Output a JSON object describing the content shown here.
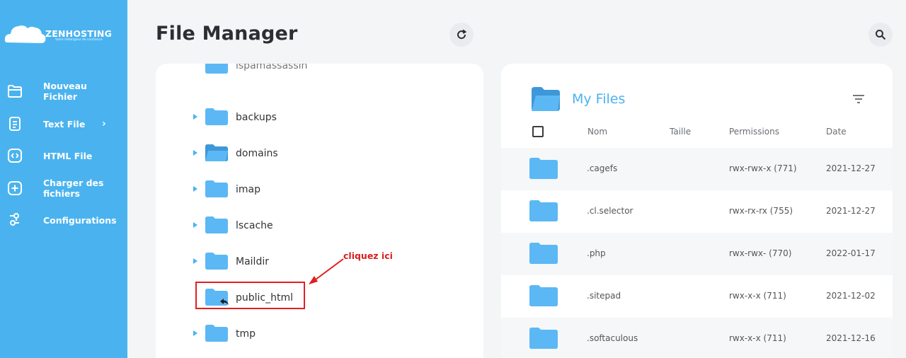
{
  "brand": {
    "name": "ZENHOSTING",
    "tagline": "Votre hébergeur de confiance"
  },
  "sidebar": {
    "items": [
      {
        "label": "Nouveau Fichier",
        "icon": "folder-outline-icon"
      },
      {
        "label": "Text File",
        "icon": "document-icon",
        "chevron": "›"
      },
      {
        "label": "HTML File",
        "icon": "code-icon"
      },
      {
        "label": "Charger des fichiers",
        "icon": "plus-box-icon"
      },
      {
        "label": "Configurations",
        "icon": "settings-sliders-icon"
      }
    ]
  },
  "header": {
    "title": "File Manager",
    "refresh_icon": "refresh-icon",
    "search_icon": "search-icon"
  },
  "tree": {
    "partial_label": "lspamassassin",
    "items": [
      {
        "label": "backups",
        "open": false
      },
      {
        "label": "domains",
        "open": true
      },
      {
        "label": "imap",
        "open": false
      },
      {
        "label": "lscache",
        "open": false
      },
      {
        "label": "Maildir",
        "open": false
      },
      {
        "label": "public_html",
        "open": false,
        "highlighted": true
      },
      {
        "label": "tmp",
        "open": false
      }
    ],
    "annotation": "cliquez ici"
  },
  "files": {
    "title": "My Files",
    "filter_icon": "filter-icon",
    "columns": {
      "name": "Nom",
      "size": "Taille",
      "permissions": "Permissions",
      "date": "Date"
    },
    "rows": [
      {
        "name": ".cagefs",
        "size": "",
        "permissions": "rwx-rwx-x (771)",
        "date": "2021-12-27"
      },
      {
        "name": ".cl.selector",
        "size": "",
        "permissions": "rwx-rx-rx (755)",
        "date": "2021-12-27"
      },
      {
        "name": ".php",
        "size": "",
        "permissions": "rwx-rwx- (770)",
        "date": "2022-01-17"
      },
      {
        "name": ".sitepad",
        "size": "",
        "permissions": "rwx-x-x (711)",
        "date": "2021-12-02"
      },
      {
        "name": ".softaculous",
        "size": "",
        "permissions": "rwx-x-x (711)",
        "date": "2021-12-16"
      }
    ]
  },
  "colors": {
    "sidebar": "#4ab3ef",
    "accent": "#4ab3ef",
    "folder": "#5bb8f5",
    "annotation": "#e02020"
  }
}
